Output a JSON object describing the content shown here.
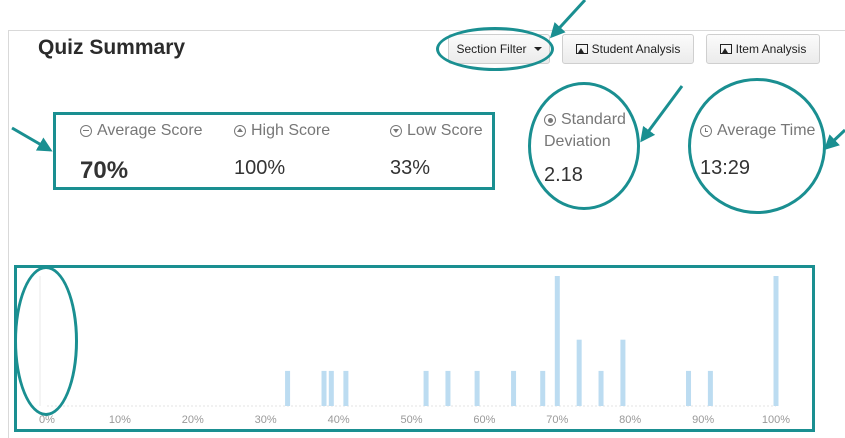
{
  "title": "Quiz Summary",
  "buttons": {
    "section_filter": "Section Filter",
    "student_analysis": "Student Analysis",
    "item_analysis": "Item Analysis"
  },
  "stats": {
    "average_score": {
      "label": "Average Score",
      "value": "70%",
      "icon": "minus-circle-icon"
    },
    "high_score": {
      "label": "High Score",
      "value": "100%",
      "icon": "up-circle-icon"
    },
    "low_score": {
      "label": "Low Score",
      "value": "33%",
      "icon": "down-circle-icon"
    },
    "std_dev": {
      "label_line1": "Standard",
      "label_line2": "Deviation",
      "value": "2.18",
      "icon": "dot-circle-icon"
    },
    "average_time": {
      "label": "Average Time",
      "value": "13:29",
      "icon": "clock-icon"
    }
  },
  "colors": {
    "annotation": "#1a8f91",
    "bar": "#bcdcf1",
    "axis_text": "#999999"
  },
  "chart_data": {
    "type": "bar",
    "x_ticks": [
      "0%",
      "10%",
      "20%",
      "30%",
      "40%",
      "50%",
      "60%",
      "70%",
      "80%",
      "90%",
      "100%"
    ],
    "xlim": [
      0,
      100
    ],
    "bars": [
      {
        "x": 33,
        "h": 0.27
      },
      {
        "x": 38,
        "h": 0.27
      },
      {
        "x": 39,
        "h": 0.27
      },
      {
        "x": 41,
        "h": 0.27
      },
      {
        "x": 52,
        "h": 0.27
      },
      {
        "x": 55,
        "h": 0.27
      },
      {
        "x": 59,
        "h": 0.27
      },
      {
        "x": 64,
        "h": 0.27
      },
      {
        "x": 68,
        "h": 0.27
      },
      {
        "x": 70,
        "h": 1.0
      },
      {
        "x": 73,
        "h": 0.51
      },
      {
        "x": 76,
        "h": 0.27
      },
      {
        "x": 79,
        "h": 0.51
      },
      {
        "x": 88,
        "h": 0.27
      },
      {
        "x": 91,
        "h": 0.27
      },
      {
        "x": 100,
        "h": 1.0
      }
    ]
  }
}
